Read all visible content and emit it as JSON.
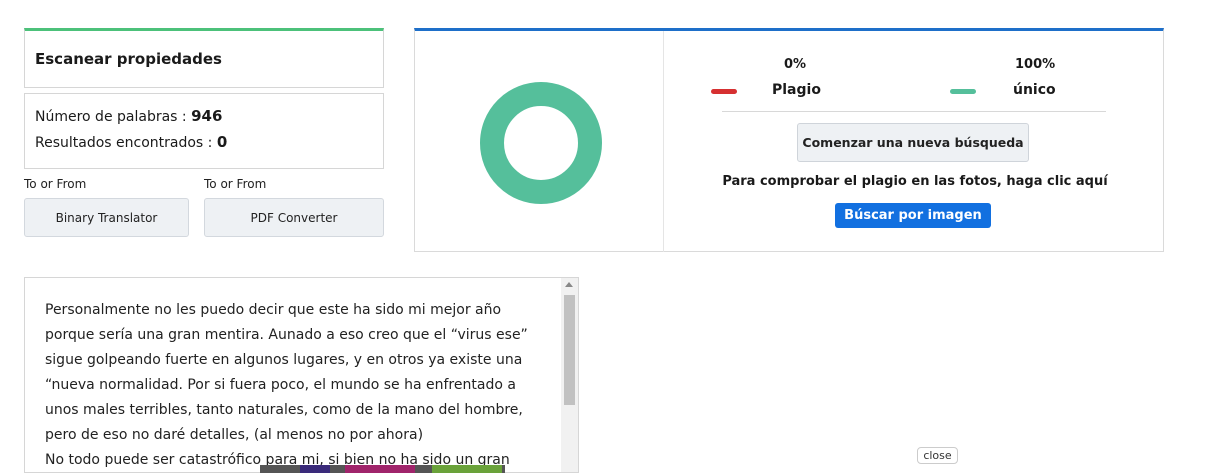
{
  "scan": {
    "title": "Escanear propiedades"
  },
  "stats": {
    "words_label": "Número de palabras : ",
    "words_value": "946",
    "results_label": "Resultados encontrados : ",
    "results_value": "0"
  },
  "tools": [
    {
      "caption": "To or From",
      "label": "Binary Translator"
    },
    {
      "caption": "To or From",
      "label": "PDF Converter"
    }
  ],
  "result": {
    "plagiarism": {
      "percent": "0%",
      "label": "Plagio",
      "color": "#d63031"
    },
    "unique": {
      "percent": "100%",
      "label": "único",
      "color": "#55bf9b"
    },
    "new_search_label": "Comenzar una nueva búsqueda",
    "photo_text": "Para comprobar el plagio en las fotos, haga clic aquí",
    "image_search_label": "Búscar por imagen",
    "donut_color": "#55bf9b"
  },
  "text": {
    "paragraphs": [
      "Personalmente no les puedo decir que este ha sido mi mejor año porque sería una gran mentira. Aunado a eso creo que el “virus ese” sigue golpeando fuerte en algunos lugares, y en otros ya existe una “nueva normalidad. Por si fuera poco, el mundo se ha enfrentado a unos males terribles, tanto naturales, como de la mano del hombre, pero de eso no daré detalles, (al menos no por ahora)",
      "No todo puede ser catastrófico para mi, si bien no ha sido un gran"
    ]
  },
  "close_label": "close"
}
